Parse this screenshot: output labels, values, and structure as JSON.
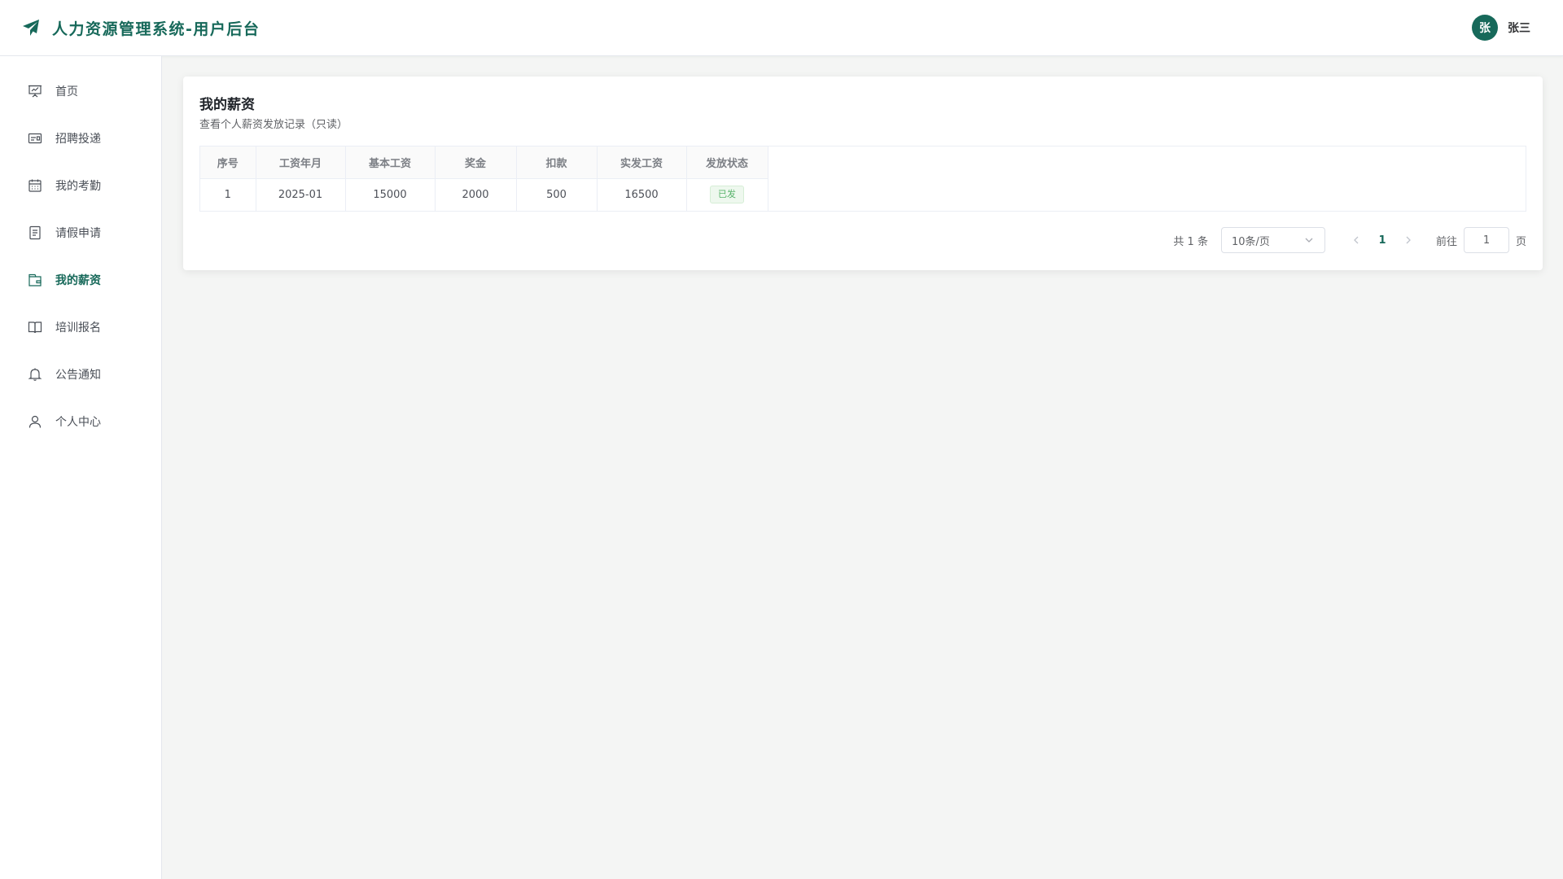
{
  "header": {
    "app_title": "人力资源管理系统-用户后台",
    "user_avatar": "张",
    "user_name": "张三"
  },
  "sidebar": {
    "items": [
      {
        "label": "首页",
        "icon": "presentation-icon"
      },
      {
        "label": "招聘投递",
        "icon": "id-card-icon"
      },
      {
        "label": "我的考勤",
        "icon": "calendar-icon"
      },
      {
        "label": "请假申请",
        "icon": "document-icon"
      },
      {
        "label": "我的薪资",
        "icon": "wallet-icon",
        "active": true
      },
      {
        "label": "培训报名",
        "icon": "book-icon"
      },
      {
        "label": "公告通知",
        "icon": "bell-icon"
      },
      {
        "label": "个人中心",
        "icon": "user-icon"
      }
    ]
  },
  "main": {
    "title": "我的薪资",
    "subtitle": "查看个人薪资发放记录（只读）",
    "table": {
      "headers": [
        "序号",
        "工资年月",
        "基本工资",
        "奖金",
        "扣款",
        "实发工资",
        "发放状态"
      ],
      "rows": [
        [
          "1",
          "2025-01",
          "15000",
          "2000",
          "500",
          "16500",
          "已发"
        ]
      ]
    },
    "pagination": {
      "total_text": "共 1 条",
      "page_size": "10条/页",
      "current_page": "1",
      "goto_label": "前往",
      "goto_value": "1",
      "page_suffix": "页"
    }
  },
  "colors": {
    "accent": "#17695a",
    "success_tag": "#59b36b"
  }
}
